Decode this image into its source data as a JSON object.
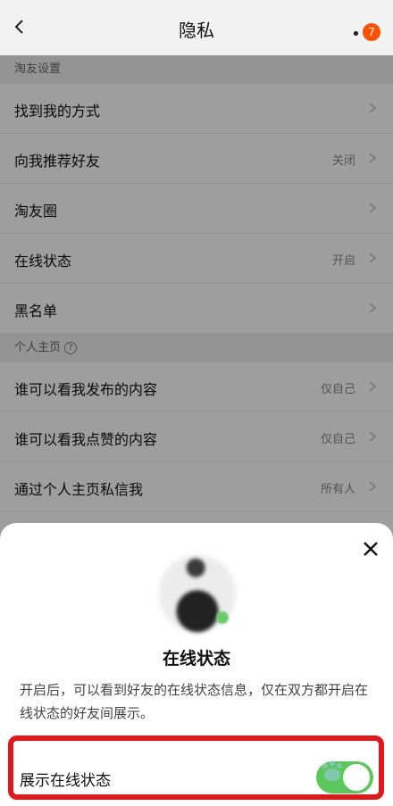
{
  "header": {
    "title": "隐私",
    "badge": "7"
  },
  "sections": [
    {
      "title": "淘友设置",
      "rows": [
        {
          "label": "找到我的方式",
          "value": ""
        },
        {
          "label": "向我推荐好友",
          "value": "关闭"
        },
        {
          "label": "淘友圈",
          "value": ""
        },
        {
          "label": "在线状态",
          "value": "开启"
        },
        {
          "label": "黑名单",
          "value": ""
        }
      ]
    },
    {
      "title": "个人主页",
      "rows": [
        {
          "label": "谁可以看我发布的内容",
          "value": "仅自己"
        },
        {
          "label": "谁可以看我点赞的内容",
          "value": "仅自己"
        },
        {
          "label": "通过个人主页私信我",
          "value": "所有人"
        }
      ]
    }
  ],
  "sheet": {
    "title": "在线状态",
    "description": "开启后，可以看到好友的在线状态信息，仅在双方都开启在线状态的好友间展示。",
    "toggle_label": "展示在线状态",
    "toggle_on": true
  },
  "colors": {
    "accent_badge": "#ff5000",
    "toggle_on": "#5bc85b",
    "highlight": "#e0181a"
  }
}
